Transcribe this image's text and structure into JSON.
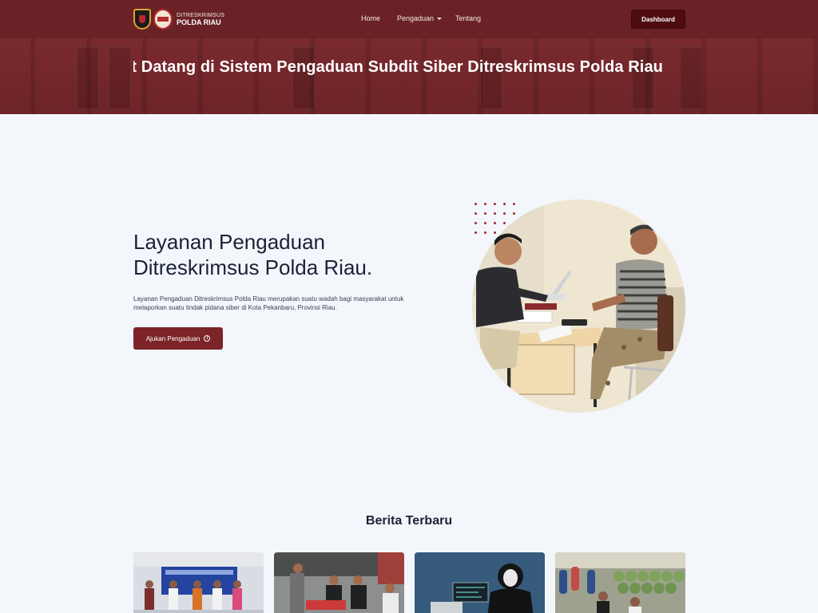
{
  "navbar": {
    "logo_line1": "DITRESKRIMSUS",
    "logo_line2": "POLDA RIAU",
    "home": "Home",
    "pengaduan": "Pengaduan",
    "tentang": "Tentang",
    "dashboard": "Dashboard"
  },
  "banner": {
    "marquee_text": "Selamat Datang di Sistem Pengaduan Subdit Siber Ditreskrimsus Polda Riau"
  },
  "hero": {
    "title_line1": "Layanan Pengaduan",
    "title_line2": "Ditreskrimsus Polda Riau.",
    "description": "Layanan Pengaduan Ditreskrimsus Polda Riau merupakan suatu wadah bagi masyarakat untuk melaporkan suatu tindak pidana siber di Kota Pekanbaru, Provinsi Riau.",
    "cta_label": "Ajukan Pengaduan"
  },
  "news": {
    "section_title": "Berita Terbaru",
    "cards": [
      {
        "name": "news-card-1"
      },
      {
        "name": "news-card-2"
      },
      {
        "name": "news-card-3"
      },
      {
        "name": "news-card-4"
      }
    ]
  },
  "colors": {
    "brand": "#6a2226",
    "button": "#7c2428",
    "dashboard_button": "#4e0c10",
    "background": "#f3f6fa"
  }
}
